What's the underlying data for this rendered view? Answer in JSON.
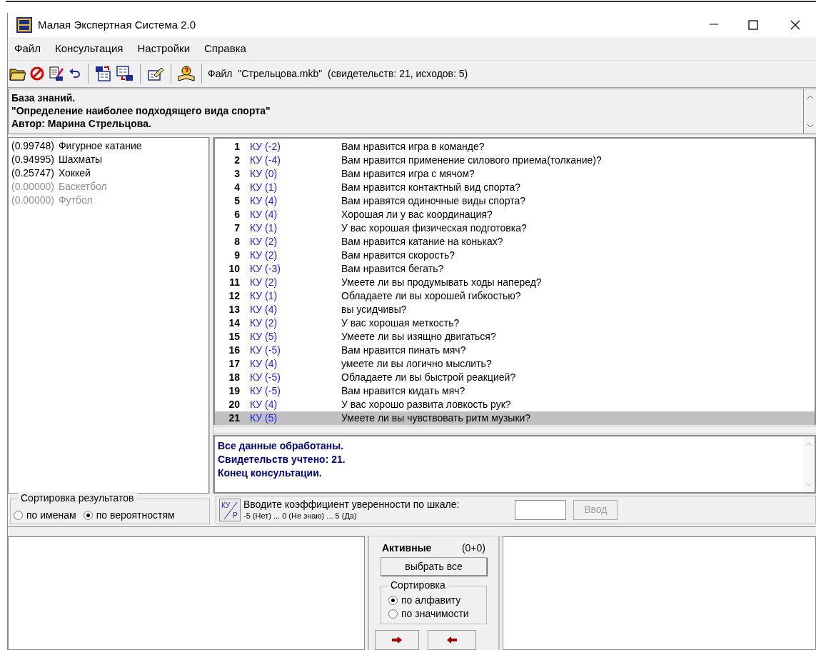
{
  "window": {
    "title": "Малая Экспертная Система 2.0"
  },
  "menu": [
    "Файл",
    "Консультация",
    "Настройки",
    "Справка"
  ],
  "toolbar": {
    "status": "Файл  \"Стрельцова.mkb\"  (свидетельств: 21, исходов: 5)"
  },
  "knowledge_base": [
    "База знаний.",
    "\"Определение наиболее подходящего вида спорта\"",
    "Автор: Марина Стрельцова."
  ],
  "results": [
    {
      "probability": "(0.99748)",
      "name": "Фигурное катание",
      "dimmed": false
    },
    {
      "probability": "(0.94995)",
      "name": "Шахматы",
      "dimmed": false
    },
    {
      "probability": "(0.25747)",
      "name": "Хоккей",
      "dimmed": false
    },
    {
      "probability": "(0.00000)",
      "name": "Баскетбол",
      "dimmed": true
    },
    {
      "probability": "(0.00000)",
      "name": "Футбол",
      "dimmed": true
    }
  ],
  "questions": [
    {
      "number": "1",
      "ku": "КУ (-2)",
      "text": "Вам нравится игра в команде?",
      "selected": false
    },
    {
      "number": "2",
      "ku": "КУ (-4)",
      "text": "Вам нравится применение силового приема(толкание)?",
      "selected": false
    },
    {
      "number": "3",
      "ku": "КУ (0)",
      "text": "Вам нравится игра с мячом?",
      "selected": false
    },
    {
      "number": "4",
      "ku": "КУ (1)",
      "text": "Вам нравится контактный вид спорта?",
      "selected": false
    },
    {
      "number": "5",
      "ku": "КУ (4)",
      "text": "Вам нравятся одиночные виды спорта?",
      "selected": false
    },
    {
      "number": "6",
      "ku": "КУ (4)",
      "text": "Хорошая ли у вас координация?",
      "selected": false
    },
    {
      "number": "7",
      "ku": "КУ (1)",
      "text": "У вас хорошая физическая подготовка?",
      "selected": false
    },
    {
      "number": "8",
      "ku": "КУ (2)",
      "text": "Вам нравится катание на коньках?",
      "selected": false
    },
    {
      "number": "9",
      "ku": "КУ (2)",
      "text": "Вам нравится скорость?",
      "selected": false
    },
    {
      "number": "10",
      "ku": "КУ (-3)",
      "text": "Вам нравится бегать?",
      "selected": false
    },
    {
      "number": "11",
      "ku": "КУ (2)",
      "text": "Умеете ли вы продумывать ходы наперед?",
      "selected": false
    },
    {
      "number": "12",
      "ku": "КУ (1)",
      "text": "Обладаете ли вы хорошей гибкостью?",
      "selected": false
    },
    {
      "number": "13",
      "ku": "КУ (4)",
      "text": "вы усидчивы?",
      "selected": false
    },
    {
      "number": "14",
      "ku": "КУ (2)",
      "text": "У вас хорошая меткость?",
      "selected": false
    },
    {
      "number": "15",
      "ku": "КУ (5)",
      "text": "Умеете ли вы изящно двигаться?",
      "selected": false
    },
    {
      "number": "16",
      "ku": "КУ (-5)",
      "text": "Вам нравится пинать мяч?",
      "selected": false
    },
    {
      "number": "17",
      "ku": "КУ (4)",
      "text": "умеете ли вы логично мыслить?",
      "selected": false
    },
    {
      "number": "18",
      "ku": "КУ (-5)",
      "text": "Обладаете ли вы быстрой реакцией?",
      "selected": false
    },
    {
      "number": "19",
      "ku": "КУ (-5)",
      "text": "Вам нравится кидать мяч?",
      "selected": false
    },
    {
      "number": "20",
      "ku": "КУ (4)",
      "text": "У вас хорошо развита ловкость рук?",
      "selected": false
    },
    {
      "number": "21",
      "ku": "КУ (5)",
      "text": "Умеете ли вы чувствовать ритм музыки?",
      "selected": true
    }
  ],
  "messages": [
    "Все данные обработаны.",
    "Свидетельств учтено: 21.",
    "Конец консультации."
  ],
  "result_sort": {
    "label": "Сортировка результатов",
    "options": [
      {
        "label": "по именам",
        "selected": false
      },
      {
        "label": "по вероятностям",
        "selected": true
      }
    ]
  },
  "input": {
    "badge_top": "КУ",
    "badge_bottom": "Р",
    "prompt": "Вводите коэффициент уверенности по шкале:",
    "scale": "-5 (Нет) ... 0 (Не знаю) ... 5 (Да)",
    "button": "Ввод",
    "disabled": true
  },
  "active_panel": {
    "title": "Активные",
    "count": "(0+0)",
    "select_all": "выбрать все",
    "sort": {
      "label": "Сортировка",
      "options": [
        {
          "label": "по алфавиту",
          "selected": true
        },
        {
          "label": "по значимости",
          "selected": false
        }
      ]
    }
  }
}
